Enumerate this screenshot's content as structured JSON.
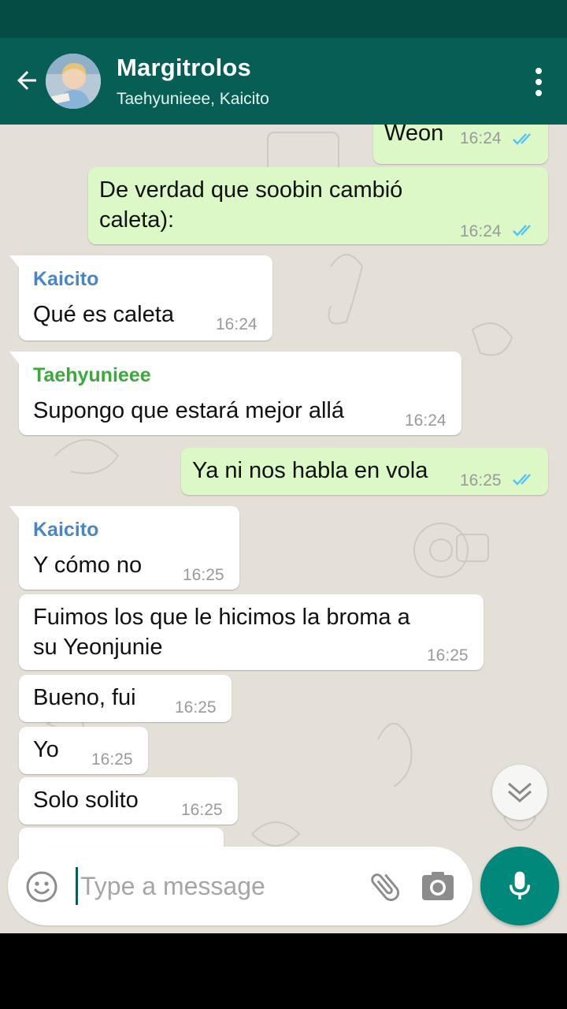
{
  "header": {
    "title": "Margitrolos",
    "subtitle": "Taehyunieee, Kaicito",
    "back_icon": "arrow-left-icon",
    "menu_icon": "more-vert-icon"
  },
  "messages": [
    {
      "direction": "out",
      "text": "Weon",
      "time": "16:24",
      "status": "read"
    },
    {
      "direction": "out",
      "text": "De verdad que soobin cambió caleta):",
      "line1": "De verdad que soobin cambió",
      "line2": "caleta):",
      "time": "16:24",
      "status": "read"
    },
    {
      "direction": "in",
      "sender": "Kaicito",
      "text": "Qué es caleta",
      "time": "16:24"
    },
    {
      "direction": "in",
      "sender": "Taehyunieee",
      "text": "Supongo que estará mejor allá",
      "time": "16:24"
    },
    {
      "direction": "out",
      "text": "Ya ni nos habla en vola",
      "time": "16:25",
      "status": "read"
    },
    {
      "direction": "in",
      "sender": "Kaicito",
      "text": "Y cómo no",
      "time": "16:25"
    },
    {
      "direction": "in",
      "text": "Fuimos los que le hicimos la broma a su Yeonjunie",
      "line1": "Fuimos los que le hicimos la broma a",
      "line2": "su Yeonjunie",
      "time": "16:25"
    },
    {
      "direction": "in",
      "text": "Bueno, fui",
      "time": "16:25"
    },
    {
      "direction": "in",
      "text": "Yo",
      "time": "16:25"
    },
    {
      "direction": "in",
      "text": "Solo solito",
      "time": "16:25"
    }
  ],
  "composer": {
    "placeholder": "Type a message",
    "emoji_icon": "emoji-icon",
    "attach_icon": "paperclip-icon",
    "camera_icon": "camera-icon",
    "mic_icon": "mic-icon"
  },
  "colors": {
    "header": "#075e54",
    "statusbar": "#054d44",
    "outgoing_bubble": "#dcf8c6",
    "incoming_bubble": "#ffffff",
    "read_ticks": "#4fc3f7",
    "sender_kaicito": "#4a86c5",
    "sender_taehyunieee": "#3aa83a",
    "mic_button": "#00897b"
  }
}
